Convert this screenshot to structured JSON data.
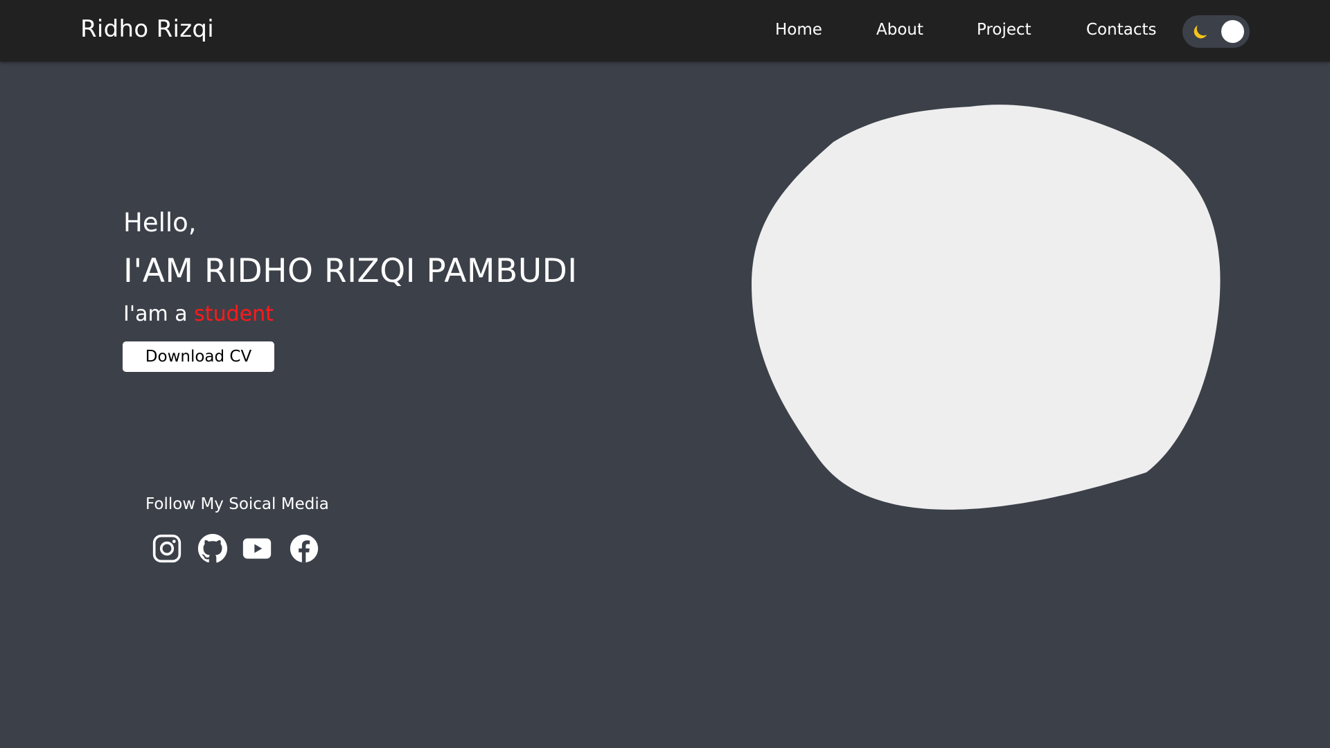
{
  "navbar": {
    "brand": "Ridho Rizqi",
    "links": [
      {
        "label": "Home"
      },
      {
        "label": "About"
      },
      {
        "label": "Project"
      },
      {
        "label": "Contacts"
      }
    ],
    "theme_toggle": {
      "icon": "moon-icon",
      "state": "dark"
    }
  },
  "hero": {
    "greeting": "Hello,",
    "name": "I'AM RIDHO RIZQI PAMBUDI",
    "role_prefix": "I'am a ",
    "role_highlight": "student",
    "cv_button": "Download CV"
  },
  "social": {
    "title": "Follow My Soical Media",
    "icons": [
      "instagram-icon",
      "github-icon",
      "youtube-icon",
      "facebook-icon"
    ]
  },
  "colors": {
    "navbar_bg": "#212121",
    "page_bg": "#3c4049",
    "highlight": "#ff1a1a",
    "moon": "#f5c518",
    "blob": "#eeeeee"
  }
}
